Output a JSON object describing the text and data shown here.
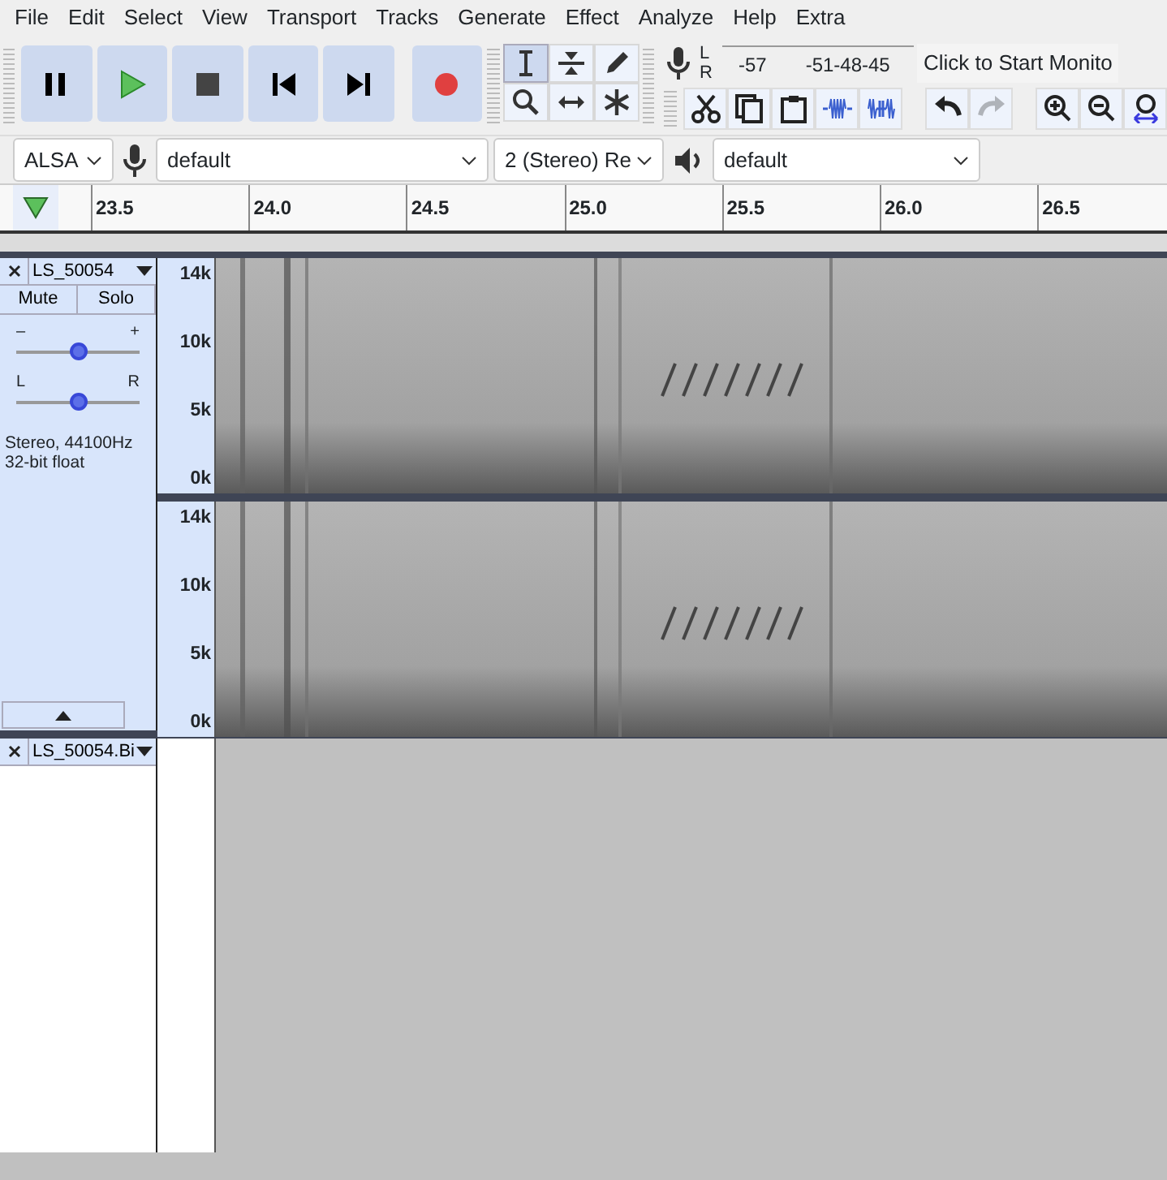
{
  "menu": [
    "File",
    "Edit",
    "Select",
    "View",
    "Transport",
    "Tracks",
    "Generate",
    "Effect",
    "Analyze",
    "Help",
    "Extra"
  ],
  "transport": [
    {
      "kind": "pause"
    },
    {
      "kind": "play"
    },
    {
      "kind": "stop"
    },
    {
      "kind": "skip-start"
    },
    {
      "kind": "skip-end"
    },
    {
      "kind": "record"
    }
  ],
  "tools": [
    {
      "kind": "select",
      "selected": true
    },
    {
      "kind": "envelope",
      "selected": false
    },
    {
      "kind": "draw",
      "selected": false
    },
    {
      "kind": "zoom",
      "selected": false
    },
    {
      "kind": "timeshift",
      "selected": false
    },
    {
      "kind": "multi",
      "selected": false
    }
  ],
  "meter": {
    "channel_labels": [
      "L",
      "R"
    ],
    "ticks": [
      "-57",
      "-51",
      "-48",
      "-45"
    ],
    "prompt": "Click to Start Monito"
  },
  "edit_buttons": [
    {
      "kind": "cut",
      "disabled": false
    },
    {
      "kind": "copy",
      "disabled": false
    },
    {
      "kind": "paste",
      "disabled": false
    },
    {
      "kind": "trim",
      "disabled": false
    },
    {
      "kind": "silence",
      "disabled": false
    },
    {
      "kind": "undo",
      "disabled": false
    },
    {
      "kind": "redo",
      "disabled": true
    },
    {
      "kind": "zoom-in",
      "disabled": false
    },
    {
      "kind": "zoom-out",
      "disabled": false
    },
    {
      "kind": "fit",
      "disabled": false
    }
  ],
  "device_bar": {
    "host": "ALSA",
    "recording_device": "default",
    "channels": "2 (Stereo) Re",
    "playback_device": "default"
  },
  "ruler": [
    "23.5",
    "24.0",
    "24.5",
    "25.0",
    "25.5",
    "26.0",
    "26.5"
  ],
  "tracks": [
    {
      "name": "LS_50054",
      "mute": "Mute",
      "solo": "Solo",
      "gain": {
        "minus": "–",
        "plus": "+",
        "level": 0.5
      },
      "pan": {
        "left": "L",
        "right": "R",
        "level": 0.5
      },
      "info": [
        "Stereo, 44100Hz",
        "32-bit float"
      ],
      "channels": [
        {
          "axis": [
            "14k",
            "10k",
            "5k",
            "0k"
          ]
        },
        {
          "axis": [
            "14k",
            "10k",
            "5k",
            "0k"
          ]
        }
      ]
    },
    {
      "name": "LS_50054.Bi"
    }
  ]
}
